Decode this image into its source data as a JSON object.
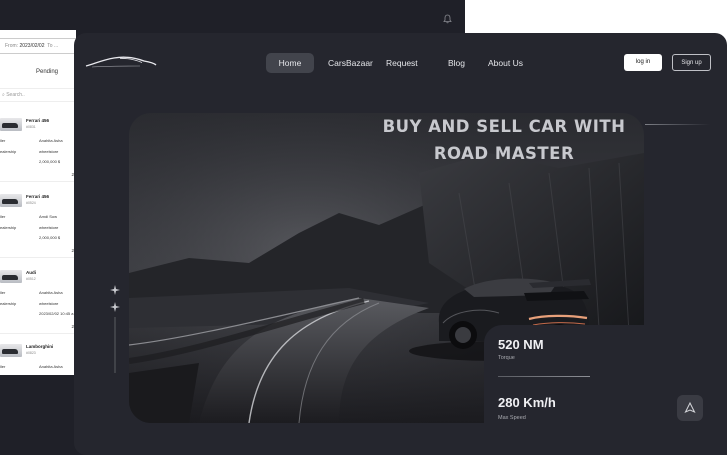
{
  "back_panel": {
    "date_range": {
      "from_label": "From",
      "from_value": "2023/02/02",
      "to_label": "To",
      "to_value": "..."
    },
    "pending_label": "Pending",
    "search_placeholder": "Search..",
    "cars": [
      {
        "name": "Ferrari 456",
        "code": "#0831",
        "role_a": "ller",
        "role_b": "ealership",
        "info_a": "Anahita Asha",
        "info_b": "wheelstore",
        "info_c": "2,000,000 $",
        "count": "2"
      },
      {
        "name": "Ferrari 456",
        "code": "#0524",
        "role_a": "ller",
        "role_b": "ealership",
        "info_a": "Amdi Sow",
        "info_b": "wheelstore",
        "info_c": "2,000,000 $",
        "count": "2"
      },
      {
        "name": "Audi",
        "code": "#0512",
        "role_a": "ller",
        "role_b": "ealership",
        "info_a": "Anahita Asha",
        "info_b": "wheelstore",
        "info_c": "2023/02/02 10:45 a",
        "count": "2"
      },
      {
        "name": "Lamborghini",
        "code": "#0823",
        "role_a": "ller",
        "role_b": "",
        "info_a": "Anahita Asha",
        "info_b": "",
        "info_c": "",
        "count": ""
      }
    ]
  },
  "nav": {
    "home": "Home",
    "carsbazaar": "CarsBazaar",
    "request": "Request",
    "blog": "Blog",
    "about": "About Us"
  },
  "auth": {
    "login": "log in",
    "signup": "Sign up"
  },
  "hero": {
    "headline_line1": "BUY AND SELL CAR WITH",
    "headline_line2": "ROAD MASTER"
  },
  "stats": [
    {
      "value": "520 NM",
      "label": "Torque"
    },
    {
      "value": "280 Km/h",
      "label": "Max Speed"
    }
  ],
  "icons": {
    "bell": "bell-icon",
    "logo": "car-silhouette-logo",
    "scroll_up": "arrow-up-icon",
    "sparkle": "sparkle-icon"
  },
  "colors": {
    "hero_bg": "#25262e",
    "accent_white": "#ffffff",
    "nav_active": "#42444c"
  }
}
